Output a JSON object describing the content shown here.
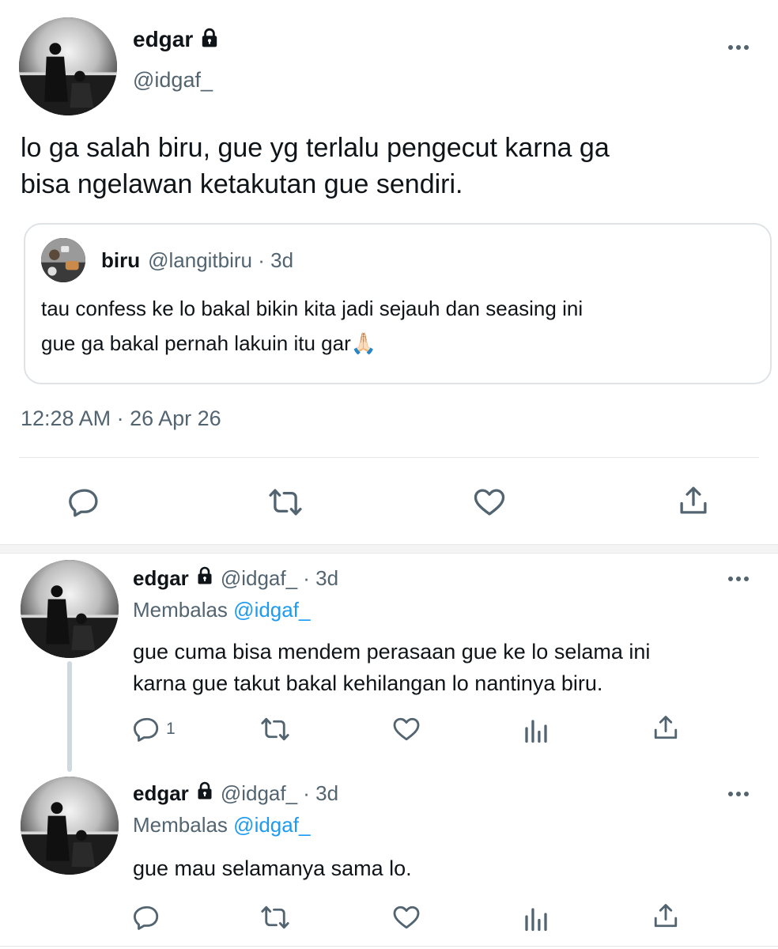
{
  "main_tweet": {
    "display_name": "edgar",
    "handle": "@idgaf_",
    "text_line1": "lo ga salah biru, gue yg terlalu pengecut karna ga",
    "text_line2": "bisa ngelawan ketakutan gue sendiri.",
    "quoted": {
      "display_name": "biru",
      "handle_time": "@langitbiru · 3d",
      "text_line1": "tau confess ke lo bakal bikin kita jadi sejauh dan seasing ini",
      "text_line2": "gue ga bakal pernah lakuin itu gar🙏🏻"
    },
    "timestamp": "12:28 AM · 26 Apr 26",
    "actions": [
      "reply-icon",
      "retweet-icon",
      "like-icon",
      "share-icon"
    ]
  },
  "replies": [
    {
      "display_name": "edgar",
      "handle_time": "@idgaf_ · 3d",
      "replying_label": "Membalas",
      "replying_to": "@idgaf_",
      "text_line1": "gue cuma bisa mendem perasaan gue ke lo selama ini",
      "text_line2": "karna gue takut bakal kehilangan lo nantinya biru.",
      "reply_count": "1"
    },
    {
      "display_name": "edgar",
      "handle_time": "@idgaf_ · 3d",
      "replying_label": "Membalas",
      "replying_to": "@idgaf_",
      "text_line1": "gue mau selamanya sama lo.",
      "text_line2": "",
      "reply_count": ""
    }
  ],
  "colors": {
    "text": "#0f1419",
    "muted": "#536471",
    "link": "#1d9bf0",
    "border": "#dfe3e6"
  }
}
